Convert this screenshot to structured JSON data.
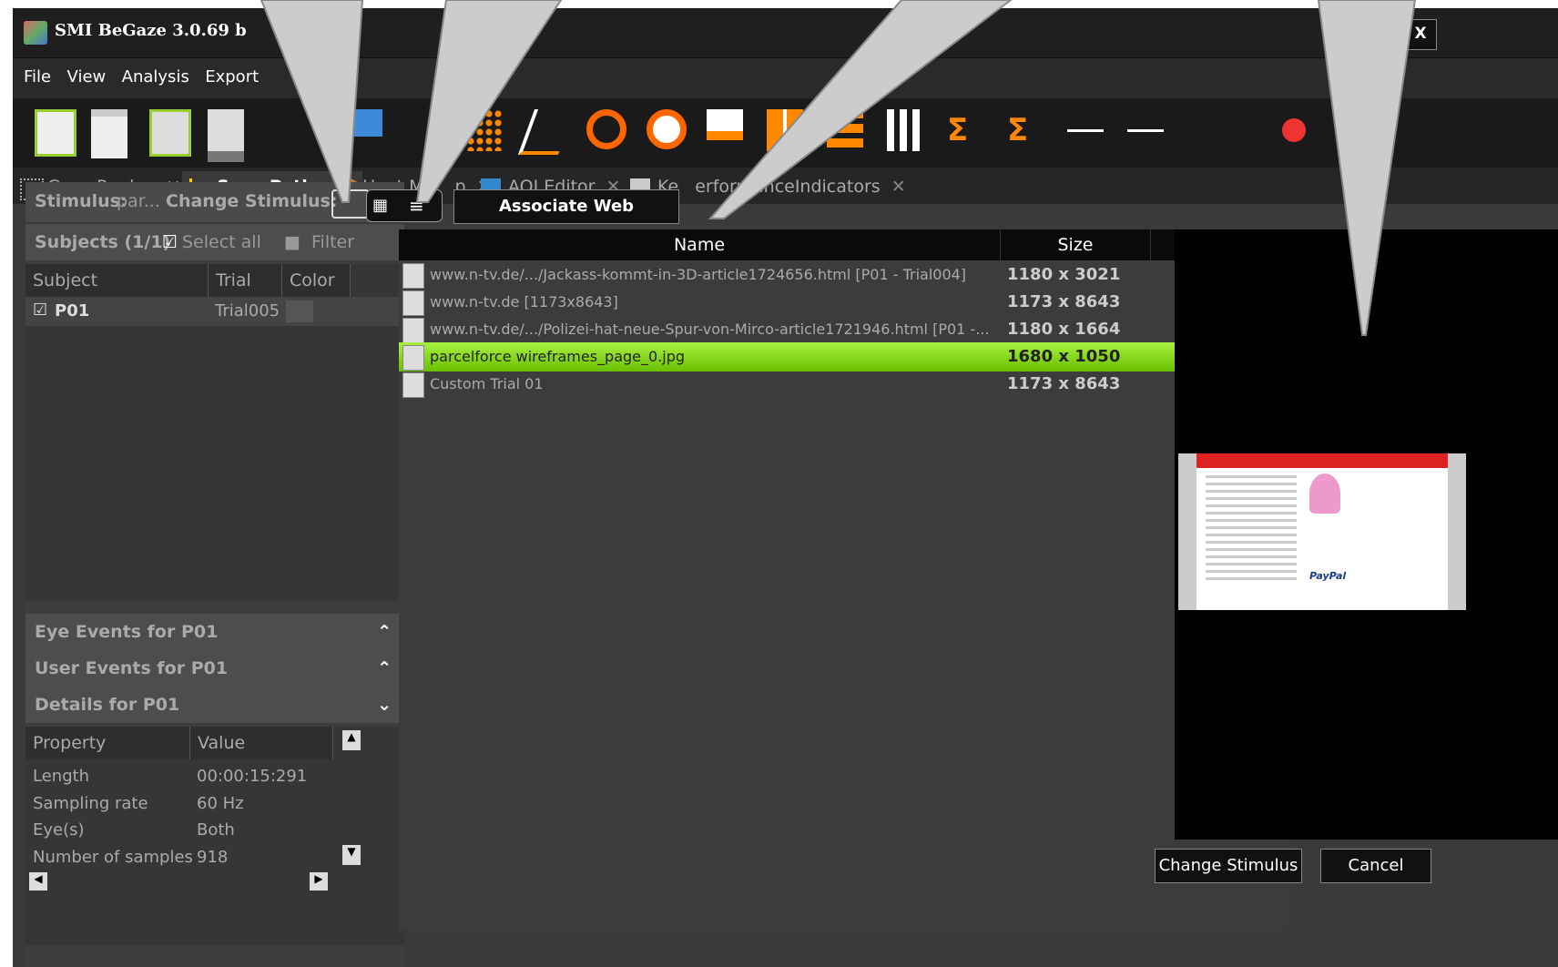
{
  "window": {
    "title": "SMI BeGaze 3.0.69 b",
    "min": "_",
    "max": "▭",
    "close": "X"
  },
  "menu": [
    "File",
    "View",
    "Analysis",
    "Export"
  ],
  "tabs": [
    {
      "label": "Gaze Replay"
    },
    {
      "label": "Scan Path"
    },
    {
      "label": "Heat M"
    },
    {
      "label": "p"
    },
    {
      "label": "AOI Editor"
    },
    {
      "label": "Ke"
    },
    {
      "label": "erformanceIndicators"
    }
  ],
  "stimulus_bar": {
    "stimulus_label": "Stimulus:",
    "stimulus_value": "par...",
    "change_label": "Change Stimulus:",
    "associate_button": "Associate Web Content..."
  },
  "subjects": {
    "title": "Subjects (1/1)",
    "select_all": "Select all",
    "filter": "Filter",
    "columns": [
      "Subject",
      "Trial",
      "Color"
    ],
    "rows": [
      {
        "subject": "P01",
        "trial": "Trial005"
      }
    ]
  },
  "sections": {
    "eye_events": "Eye Events for P01",
    "user_events": "User Events for P01",
    "details": "Details for P01"
  },
  "details": {
    "columns": [
      "Property",
      "Value"
    ],
    "rows": [
      {
        "property": "Length",
        "value": "00:00:15:291"
      },
      {
        "property": "Sampling rate",
        "value": "60 Hz"
      },
      {
        "property": "Eye(s)",
        "value": "Both"
      },
      {
        "property": "Number of samples",
        "value": "918"
      }
    ]
  },
  "stimulus_list": {
    "columns": [
      "Name",
      "Size"
    ],
    "rows": [
      {
        "name": "www.n-tv.de/.../Jackass-kommt-in-3D-article1724656.html [P01 - Trial004]",
        "size": "1180 x 3021"
      },
      {
        "name": "www.n-tv.de [1173x8643]",
        "size": "1173 x 8643"
      },
      {
        "name": "www.n-tv.de/.../Polizei-hat-neue-Spur-von-Mirco-article1721946.html [P01 -...",
        "size": "1180 x 1664"
      },
      {
        "name": "parcelforce wireframes_page_0.jpg",
        "size": "1680 x 1050",
        "selected": true
      },
      {
        "name": "Custom Trial 01",
        "size": "1173 x 8643"
      }
    ]
  },
  "buttons": {
    "change_stimulus": "Change Stimulus",
    "cancel": "Cancel"
  },
  "preview": {
    "logo": "PayPal"
  },
  "colors": {
    "selection": "#8cd820",
    "background": "#3a3a3a"
  }
}
